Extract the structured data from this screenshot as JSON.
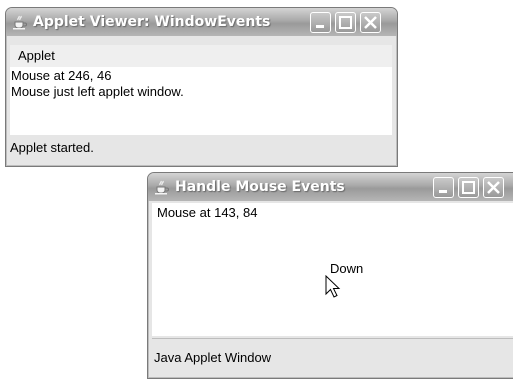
{
  "window1": {
    "title": "Applet Viewer: WindowEvents",
    "menu": {
      "applet_label": "Applet"
    },
    "content": {
      "line1": "Mouse at 246, 46",
      "line2": "Mouse just left applet window."
    },
    "status": "Applet started."
  },
  "window2": {
    "title": "Handle Mouse Events",
    "content": {
      "mouse_position": "Mouse at 143, 84",
      "button_state": "Down"
    },
    "status": "Java Applet Window"
  },
  "icons": [
    "java-cup-icon",
    "minimize-icon",
    "maximize-icon",
    "close-icon",
    "mouse-cursor-icon"
  ]
}
